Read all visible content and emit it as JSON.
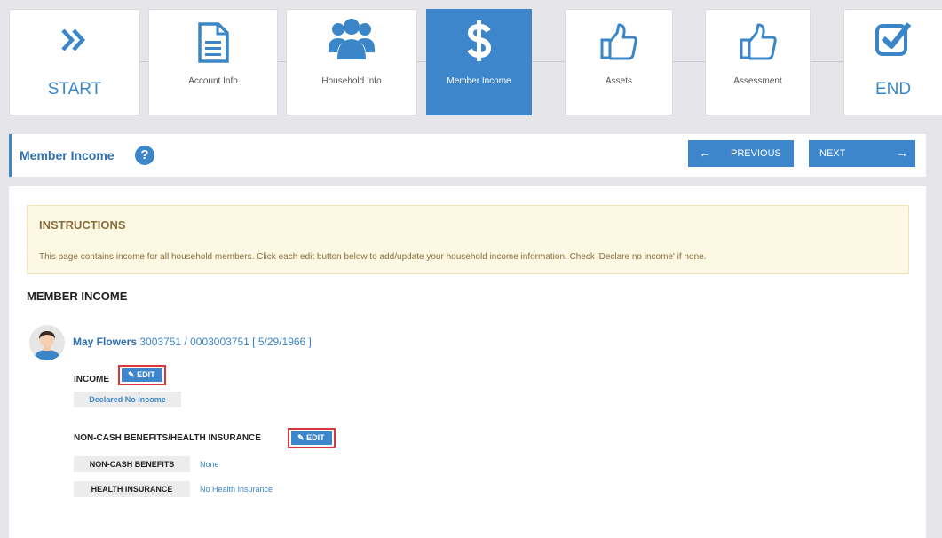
{
  "steps": [
    {
      "label": "START",
      "icon": "double-chevron-right-icon"
    },
    {
      "label": "Account Info",
      "icon": "document-icon"
    },
    {
      "label": "Household Info",
      "icon": "users-icon"
    },
    {
      "label": "Member Income",
      "icon": "dollar-icon",
      "active": true
    },
    {
      "label": "Assets",
      "icon": "thumbs-up-icon"
    },
    {
      "label": "Assessment",
      "icon": "thumbs-up-icon"
    },
    {
      "label": "END",
      "icon": "checkbox-icon"
    }
  ],
  "header": {
    "title": "Member Income",
    "help": "?",
    "previous_label": "PREVIOUS",
    "next_label": "NEXT"
  },
  "instructions": {
    "heading": "INSTRUCTIONS",
    "text": "This page contains income for all household members. Click each edit button below to add/update your household income information. Check 'Declare no income' if none."
  },
  "section_title": "MEMBER INCOME",
  "member": {
    "name": "May Flowers",
    "ids": "3003751 / 0003003751 [ 5/29/1966 ]",
    "income_label": "INCOME",
    "edit_label": "EDIT",
    "income_status": "Declared No Income",
    "benefits_label": "NON-CASH BENEFITS/HEALTH INSURANCE",
    "rows": [
      {
        "label": "NON-CASH BENEFITS",
        "value": "None"
      },
      {
        "label": "HEALTH INSURANCE",
        "value": "No Health Insurance"
      }
    ]
  },
  "colors": {
    "accent": "#3d86cc",
    "highlight_border": "#d9363e",
    "instructions_bg": "#fcf8e3"
  }
}
